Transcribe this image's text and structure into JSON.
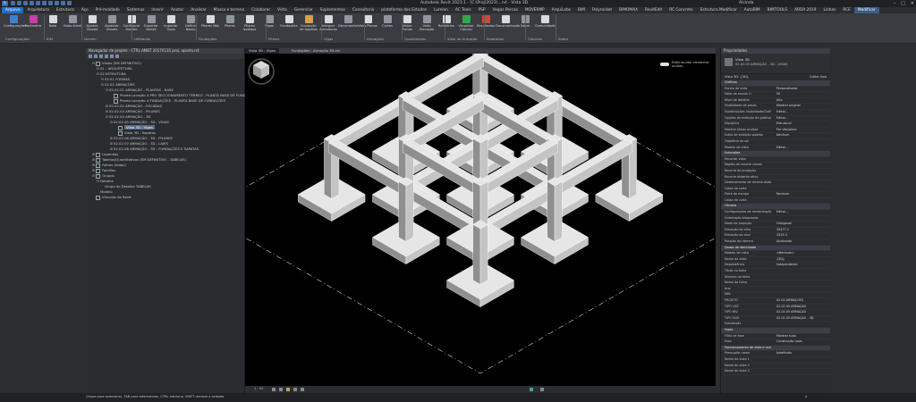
{
  "window": {
    "title": "Autodesk Revit 2023.1 - [C:\\Proj\\2023\\...rvt - Vista 3D: {3D}]",
    "user": "Alcinda"
  },
  "tabs": [
    "Arquivo",
    "Arquitetura",
    "Estrutura",
    "Aço",
    "Pré-moldado",
    "Sistemas",
    "Inserir",
    "Anotar",
    "Analisar",
    "Massa e terreno",
    "Colaborar",
    "Vista",
    "Gerenciar",
    "Suplementos",
    "Consultoria",
    "plataforma dos Estudos",
    "Lumion",
    "AC Tools",
    "PSP",
    "Vegas Porcas",
    "MOVERMP",
    "ArquiLabs",
    "BIM",
    "Polyrocket",
    "BIMOMAX",
    "RevitEdit",
    "RC Concreto",
    "Estrutura Modificar",
    "AutoBIM",
    "BIMTOOLS",
    "ARDA 2019",
    "Linhas",
    "RCE",
    "Modificar"
  ],
  "active_tab": "Arquivo",
  "context_tab": "Modificar",
  "ribbon": {
    "buttons": [
      {
        "label": "Configurações",
        "color": "#3f7fd6"
      },
      {
        "label": "Parâmetro",
        "color": "#c83ea8"
      },
      {
        "label": "Nota",
        "color": "#d7dade"
      },
      {
        "label": "Visão Geral",
        "color": "#8f96a0"
      },
      {
        "label": "Ajustes Visuais",
        "color": "#d7dade"
      },
      {
        "label": "Atualizar Visuais",
        "color": "#8f96a0"
      },
      {
        "label": "Configurar Modelo",
        "color": "#d7dade"
      },
      {
        "label": "Exportar Dados",
        "color": "#8f96a0"
      },
      {
        "label": "Importar Tipos",
        "color": "#d7dade"
      },
      {
        "label": "Definir Bases",
        "color": "#8f96a0"
      },
      {
        "label": "Pilares Nós",
        "color": "#d7dade"
      },
      {
        "label": "Pilares",
        "color": "#8f96a0"
      },
      {
        "label": "Pilares Isolados",
        "color": "#d7dade"
      },
      {
        "label": "Vigas",
        "color": "#8f96a0"
      },
      {
        "label": "Fundações",
        "color": "#d7dade"
      },
      {
        "label": "Fundação de Sapatas",
        "color": "#d9a04a"
      },
      {
        "label": "Integrar Armaduras",
        "color": "#d7dade"
      },
      {
        "label": "Documentar",
        "color": "#8f96a0"
      },
      {
        "label": "Vista Planos",
        "color": "#d7dade"
      },
      {
        "label": "Cortes",
        "color": "#8f96a0"
      },
      {
        "label": "Vistas Planos",
        "color": "#d7dade"
      },
      {
        "label": "Vista Elevação",
        "color": "#8f96a0"
      },
      {
        "label": "Relatórios",
        "color": "#d7dade"
      },
      {
        "label": "Visualizar Cálculo",
        "color": "#2fa84a"
      },
      {
        "label": "Resultados",
        "color": "#d6453a"
      },
      {
        "label": "Documentação",
        "color": "#d7dade"
      },
      {
        "label": "Sobre",
        "color": "#8f96a0"
      },
      {
        "label": "Comunidade",
        "color": "#d7dade"
      }
    ],
    "panels": [
      "Configurações",
      "BIM",
      "Nuvem",
      "Utilitários",
      "Fundações",
      "Pilares",
      "Vigas",
      "Armações",
      "Quantidades",
      "Vista de Armação",
      "Relatórios",
      "Cálculos",
      "Sobre"
    ]
  },
  "left_panel": {
    "header": "Navegador de projeto - CTRL AMBT 20170135 proj. aposto.rvt",
    "tree": [
      {
        "indent": 1,
        "tw": "⊟",
        "label": "Vistas (EM DEFINITIVO)",
        "box": true
      },
      {
        "indent": 2,
        "tw": "⊟",
        "label": "01 - ARQUITETURA",
        "box": false
      },
      {
        "indent": 2,
        "tw": "⊟",
        "label": "02 ESTRUTURA",
        "box": false
      },
      {
        "indent": 3,
        "tw": "⊟",
        "label": "02.01 FORMAS",
        "box": false
      },
      {
        "indent": 3,
        "tw": "⊟",
        "label": "02.02 ARMAÇÕES",
        "box": false
      },
      {
        "indent": 4,
        "tw": "⊟",
        "label": "02.02.01 ARMAÇÃO - PLANTAS - BASE",
        "box": false
      },
      {
        "indent": 5,
        "tw": "",
        "label": "Planta Locação 4 PRO SECCIONAMENTO TÉRREO - PLANTA BASE DE FUND",
        "box": true
      },
      {
        "indent": 5,
        "tw": "",
        "label": "Planta Locação 4 FUNDAÇÕES - PLANTA BASE DE FUNDAÇÕES",
        "box": true
      },
      {
        "indent": 4,
        "tw": "⊞",
        "label": "02.02.02 ARMAÇÃO - ESCADAS",
        "box": false
      },
      {
        "indent": 4,
        "tw": "⊞",
        "label": "02.02.03 ARMAÇÃO - PILARES",
        "box": false
      },
      {
        "indent": 4,
        "tw": "⊟",
        "label": "02.02.04 ARMAÇÃO - 3D",
        "box": false
      },
      {
        "indent": 5,
        "tw": "⊟",
        "label": "02.02.05 ARMAÇÃO - 3D - VIGAS",
        "box": false
      },
      {
        "indent": 6,
        "tw": "",
        "label": "Vista 3D - Vigas",
        "box": true,
        "hl": true
      },
      {
        "indent": 6,
        "tw": "",
        "label": "Vista 3D - Sapatas",
        "box": true
      },
      {
        "indent": 5,
        "tw": "⊞",
        "label": "02.02.06 ARMAÇÃO - 3D - PILARES",
        "box": false
      },
      {
        "indent": 5,
        "tw": "⊞",
        "label": "02.02.07 ARMAÇÃO - 3D - LAJES",
        "box": false
      },
      {
        "indent": 5,
        "tw": "⊞",
        "label": "02.02.08 ARMAÇÃO - 3D - FUNDAÇÕES E SAPATAS",
        "box": false
      },
      {
        "indent": 1,
        "tw": "⊞",
        "label": "Legendas",
        "box": true
      },
      {
        "indent": 1,
        "tw": "⊞",
        "label": "Tabelas/Quantitativos (EM DEFINITIVO - TABELAS)",
        "box": true
      },
      {
        "indent": 1,
        "tw": "⊞",
        "label": "Folhas (todas)",
        "box": true
      },
      {
        "indent": 1,
        "tw": "⊞",
        "label": "Famílias",
        "box": true
      },
      {
        "indent": 1,
        "tw": "⊟",
        "label": "Grupos",
        "box": true
      },
      {
        "indent": 2,
        "tw": "⊟",
        "label": "Detalhe",
        "box": false
      },
      {
        "indent": 3,
        "tw": "",
        "label": "Grupo do Detalhe TABELAS",
        "box": false
      },
      {
        "indent": 2,
        "tw": "",
        "label": "Modelo",
        "box": false
      },
      {
        "indent": 1,
        "tw": "",
        "label": "Vínculos do Revit",
        "box": true
      }
    ]
  },
  "view_tabs": [
    "Vista 3D - Vigas",
    "Fundações - Armação 3D.rvt"
  ],
  "canvas": {
    "toggle_label": "Exibir/ocultar elementos ocultos"
  },
  "view_bar": {
    "scale": "1 : 50"
  },
  "right_panel": {
    "header": "Propriedades",
    "type_line1": "Vista 3D",
    "type_line2": "02.02.05 ARMAÇÃO - 3D - VIGAS",
    "selector": "Vista 3D: {3D}",
    "edit_type": "Editar tipo",
    "rows": [
      {
        "group": true,
        "k": "Gráficos",
        "v": ""
      },
      {
        "k": "Escala da vista",
        "v": "Personalizada"
      },
      {
        "k": "Valor de escala 1:",
        "v": "50"
      },
      {
        "k": "Nível de detalhe",
        "v": "Alto"
      },
      {
        "k": "Visibilidade de peças",
        "v": "Mostrar original"
      },
      {
        "k": "Substituições Visibilidade/Gráficos",
        "v": "Editar..."
      },
      {
        "k": "Opções de exibição de gráficos",
        "v": "Editar..."
      },
      {
        "k": "Disciplina",
        "v": "Estrutural"
      },
      {
        "k": "Mostrar linhas ocultas",
        "v": "Por disciplina"
      },
      {
        "k": "Estilo de exibição padrão",
        "v": "Nenhum"
      },
      {
        "k": "Trajetória do sol",
        "v": ""
      },
      {
        "k": "Modelo de vista",
        "v": "Editar..."
      },
      {
        "group": true,
        "k": "Extensões",
        "v": ""
      },
      {
        "k": "Recortar vista",
        "v": ""
      },
      {
        "k": "Região de recorte visível",
        "v": ""
      },
      {
        "k": "Recorte de anotação",
        "v": ""
      },
      {
        "k": "Recorte distante ativo",
        "v": ""
      },
      {
        "k": "Deslocamento de recorte distante",
        "v": ""
      },
      {
        "k": "Caixa de corte",
        "v": ""
      },
      {
        "k": "Parte do escopo",
        "v": "Nenhum"
      },
      {
        "k": "Caixa de corte",
        "v": ""
      },
      {
        "group": true,
        "k": "Câmera",
        "v": ""
      },
      {
        "k": "Configurações de renderização",
        "v": "Editar..."
      },
      {
        "k": "Orientação bloqueada",
        "v": ""
      },
      {
        "k": "Modo de projeção",
        "v": "Ortogonal"
      },
      {
        "k": "Elevação do olho",
        "v": "20477.1"
      },
      {
        "k": "Elevação do alvo",
        "v": "3315.3"
      },
      {
        "k": "Posição da câmera",
        "v": "Ajustando"
      },
      {
        "group": true,
        "k": "Dados de identidade",
        "v": ""
      },
      {
        "k": "Modelo de vista",
        "v": "<Nenhum>"
      },
      {
        "k": "Nome da vista",
        "v": "{3D}"
      },
      {
        "k": "Dependência",
        "v": "Independente"
      },
      {
        "k": "Título na folha",
        "v": ""
      },
      {
        "k": "Número da folha",
        "v": ""
      },
      {
        "k": "Nome da folha",
        "v": ""
      },
      {
        "k": "Ano",
        "v": ""
      },
      {
        "k": "Mês",
        "v": ""
      },
      {
        "k": "PROJETO",
        "v": "02.02 ARMAÇÕES"
      },
      {
        "k": "TIPO LIST.",
        "v": "02.02.05 ARMAÇÃO"
      },
      {
        "k": "TIPO NÍV.",
        "v": "02.02.05 ARMAÇÃO"
      },
      {
        "k": "TIPO SUB.",
        "v": "02.02.05 ARMAÇÃO - 3D"
      },
      {
        "k": "Subdivisão",
        "v": ""
      },
      {
        "group": true,
        "k": "Fases",
        "v": ""
      },
      {
        "k": "Filtro de fase",
        "v": "Mostrar tudo"
      },
      {
        "k": "Fase",
        "v": "Construção nova"
      },
      {
        "group": true,
        "k": "Posicionamento de vista e nomenclatura",
        "v": ""
      },
      {
        "k": "Pressupõe nome",
        "v": "Indefinido"
      },
      {
        "k": "Nome de vista 1",
        "v": ""
      },
      {
        "k": "Nome de vista 2",
        "v": ""
      },
      {
        "k": "Nome de vista 3",
        "v": ""
      }
    ]
  },
  "status": {
    "text": "Clique para selecionar, TAB para alternativas, CTRL adiciona, SHIFT remove a seleção",
    "zoom": "0"
  }
}
